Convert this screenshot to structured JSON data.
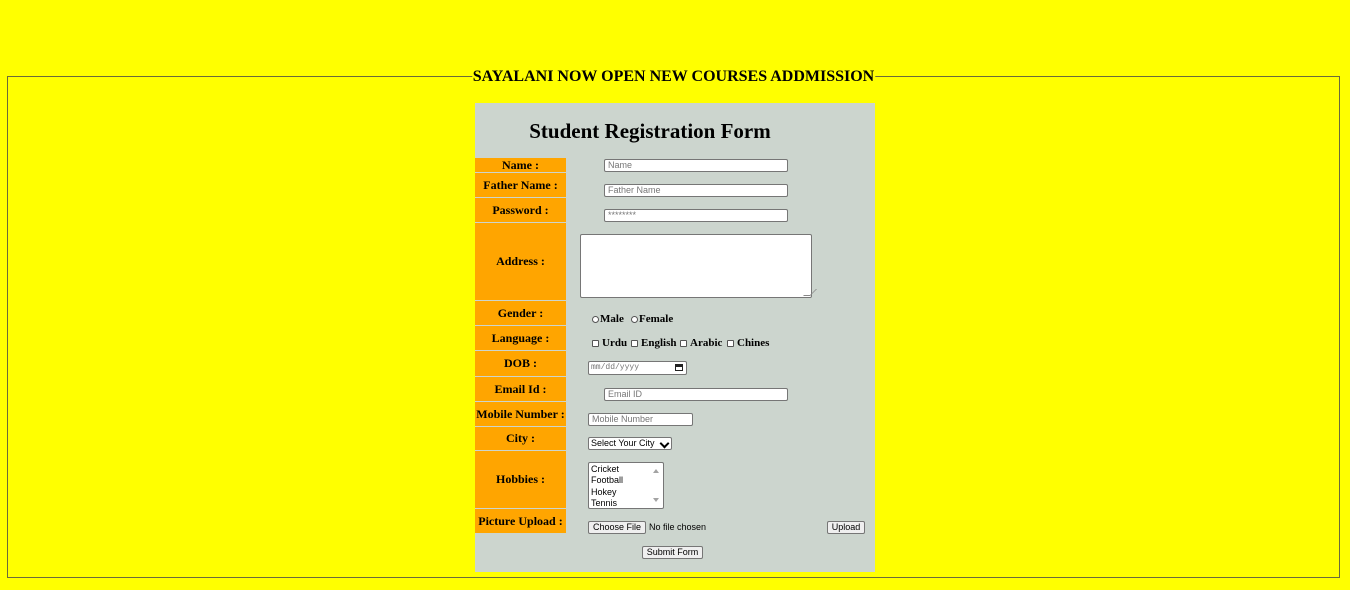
{
  "legend": "SAYALANI NOW OPEN NEW COURSES ADDMISSION",
  "form": {
    "title": "Student Registration Form",
    "labels": {
      "name": "Name :",
      "father_name": "Father Name :",
      "password": "Password :",
      "address": "Address :",
      "gender": "Gender :",
      "language": "Language :",
      "dob": "DOB :",
      "email": "Email Id :",
      "mobile": "Mobile Number :",
      "city": "City :",
      "hobbies": "Hobbies :",
      "picture": "Picture Upload :"
    },
    "placeholders": {
      "name": "Name",
      "father_name": "Father Name",
      "password": "********",
      "email": "Email ID",
      "mobile": "Mobile Number",
      "dob": "mm/dd/yyyy"
    },
    "gender_options": [
      "Male",
      "Female"
    ],
    "language_options": [
      "Urdu",
      "English",
      "Arabic",
      "Chines"
    ],
    "city_selected": "Select Your City",
    "hobbies": [
      "Cricket",
      "Football",
      "Hokey",
      "Tennis"
    ],
    "file_button": "Choose File",
    "file_status": "No file chosen",
    "upload_button": "Upload",
    "submit_button": "Submit Form"
  },
  "colors": {
    "page_background": "#ffff00",
    "form_background": "#ccd5ce",
    "label_background": "#ffa500"
  }
}
